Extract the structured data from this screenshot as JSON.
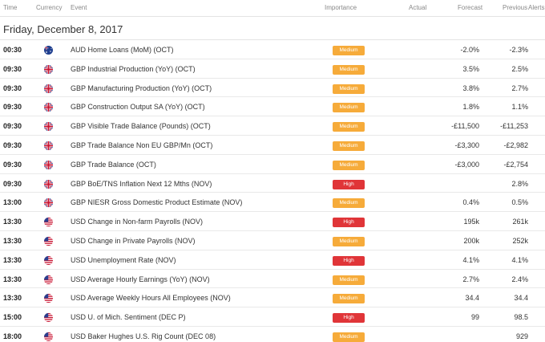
{
  "header": {
    "time": "Time",
    "currency": "Currency",
    "event": "Event",
    "importance": "Importance",
    "actual": "Actual",
    "forecast": "Forecast",
    "previous": "Previous",
    "alerts": "Alerts"
  },
  "date_label": "Friday, December 8, 2017",
  "colors": {
    "medium": "#f6ab3a",
    "high": "#e03538"
  },
  "rows": [
    {
      "time": "00:30",
      "flag": "au-flag-icon",
      "event": "AUD Home Loans (MoM) (OCT)",
      "importance": "Medium",
      "forecast": "-2.0%",
      "previous": "-2.3%"
    },
    {
      "time": "09:30",
      "flag": "gb-flag-icon",
      "event": "GBP Industrial Production (YoY) (OCT)",
      "importance": "Medium",
      "forecast": "3.5%",
      "previous": "2.5%"
    },
    {
      "time": "09:30",
      "flag": "gb-flag-icon",
      "event": "GBP Manufacturing Production (YoY) (OCT)",
      "importance": "Medium",
      "forecast": "3.8%",
      "previous": "2.7%"
    },
    {
      "time": "09:30",
      "flag": "gb-flag-icon",
      "event": "GBP Construction Output SA (YoY) (OCT)",
      "importance": "Medium",
      "forecast": "1.8%",
      "previous": "1.1%"
    },
    {
      "time": "09:30",
      "flag": "gb-flag-icon",
      "event": "GBP Visible Trade Balance (Pounds) (OCT)",
      "importance": "Medium",
      "forecast": "-£11,500",
      "previous": "-£11,253"
    },
    {
      "time": "09:30",
      "flag": "gb-flag-icon",
      "event": "GBP Trade Balance Non EU GBP/Mn (OCT)",
      "importance": "Medium",
      "forecast": "-£3,300",
      "previous": "-£2,982"
    },
    {
      "time": "09:30",
      "flag": "gb-flag-icon",
      "event": "GBP Trade Balance (OCT)",
      "importance": "Medium",
      "forecast": "-£3,000",
      "previous": "-£2,754"
    },
    {
      "time": "09:30",
      "flag": "gb-flag-icon",
      "event": "GBP BoE/TNS Inflation Next 12 Mths (NOV)",
      "importance": "High",
      "forecast": "",
      "previous": "2.8%"
    },
    {
      "time": "13:00",
      "flag": "gb-flag-icon",
      "event": "GBP NIESR Gross Domestic Product Estimate (NOV)",
      "importance": "Medium",
      "forecast": "0.4%",
      "previous": "0.5%"
    },
    {
      "time": "13:30",
      "flag": "us-flag-icon",
      "event": "USD Change in Non-farm Payrolls (NOV)",
      "importance": "High",
      "forecast": "195k",
      "previous": "261k"
    },
    {
      "time": "13:30",
      "flag": "us-flag-icon",
      "event": "USD Change in Private Payrolls (NOV)",
      "importance": "Medium",
      "forecast": "200k",
      "previous": "252k"
    },
    {
      "time": "13:30",
      "flag": "us-flag-icon",
      "event": "USD Unemployment Rate (NOV)",
      "importance": "High",
      "forecast": "4.1%",
      "previous": "4.1%"
    },
    {
      "time": "13:30",
      "flag": "us-flag-icon",
      "event": "USD Average Hourly Earnings (YoY) (NOV)",
      "importance": "Medium",
      "forecast": "2.7%",
      "previous": "2.4%"
    },
    {
      "time": "13:30",
      "flag": "us-flag-icon",
      "event": "USD Average Weekly Hours All Employees (NOV)",
      "importance": "Medium",
      "forecast": "34.4",
      "previous": "34.4"
    },
    {
      "time": "15:00",
      "flag": "us-flag-icon",
      "event": "USD U. of Mich. Sentiment (DEC P)",
      "importance": "High",
      "forecast": "99",
      "previous": "98.5"
    },
    {
      "time": "18:00",
      "flag": "us-flag-icon",
      "event": "USD Baker Hughes U.S. Rig Count (DEC 08)",
      "importance": "Medium",
      "forecast": "",
      "previous": "929"
    }
  ]
}
